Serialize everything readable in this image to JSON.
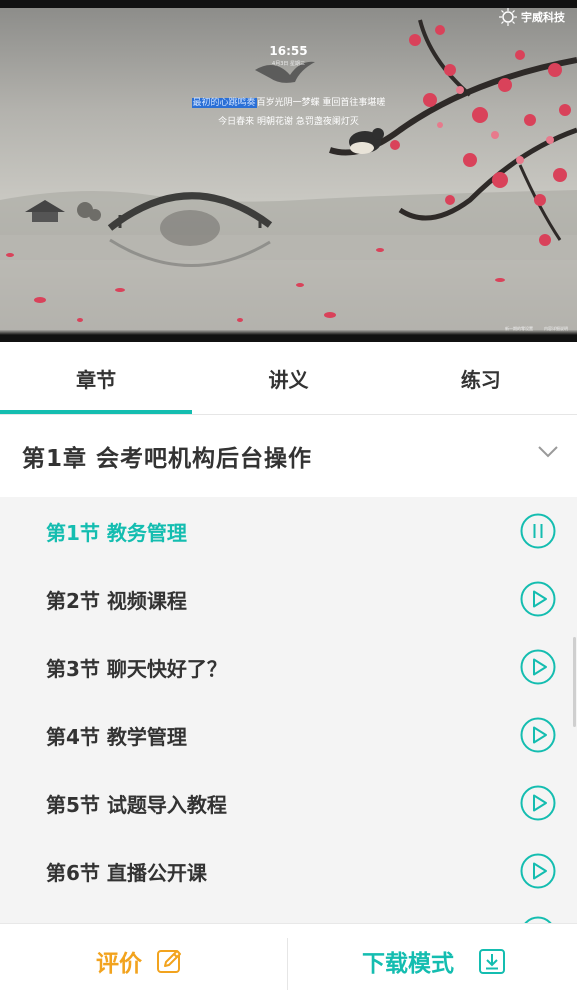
{
  "video": {
    "brand": "宇威科技",
    "clock": "16:55",
    "clock_sub": "4月3日 星期三",
    "poem_line1_highlight": "最初的心跳鸣奏",
    "poem_line1_rest": "百岁光阴一梦蝶 重回首往事堪嗟",
    "poem_line2": "今日春来 明朝花谢 急罚盏夜阑灯灭",
    "corner_left": "新一期的零设置",
    "corner_right": "内容详细说明"
  },
  "tabs": [
    {
      "label": "章节",
      "active": true
    },
    {
      "label": "讲义",
      "active": false
    },
    {
      "label": "练习",
      "active": false
    }
  ],
  "chapter": {
    "title": "第1章  会考吧机构后台操作",
    "icon": "chevron-down-icon"
  },
  "sections": [
    {
      "label": "第1节  教务管理",
      "active": true,
      "icon": "pause-icon"
    },
    {
      "label": "第2节  视频课程",
      "active": false,
      "icon": "play-icon"
    },
    {
      "label": "第3节  聊天快好了？",
      "active": false,
      "icon": "play-icon"
    },
    {
      "label": "第4节  教学管理",
      "active": false,
      "icon": "play-icon"
    },
    {
      "label": "第5节  试题导入教程",
      "active": false,
      "icon": "play-icon"
    },
    {
      "label": "第6节  直播公开课",
      "active": false,
      "icon": "play-icon"
    }
  ],
  "bottom": {
    "rate_label": "评价",
    "rate_icon": "edit-icon",
    "download_label": "下载模式",
    "download_icon": "download-icon"
  },
  "colors": {
    "accent": "#14bdb0",
    "rate": "#f2a31e",
    "text": "#333333",
    "list_bg": "#f4f4f4"
  }
}
